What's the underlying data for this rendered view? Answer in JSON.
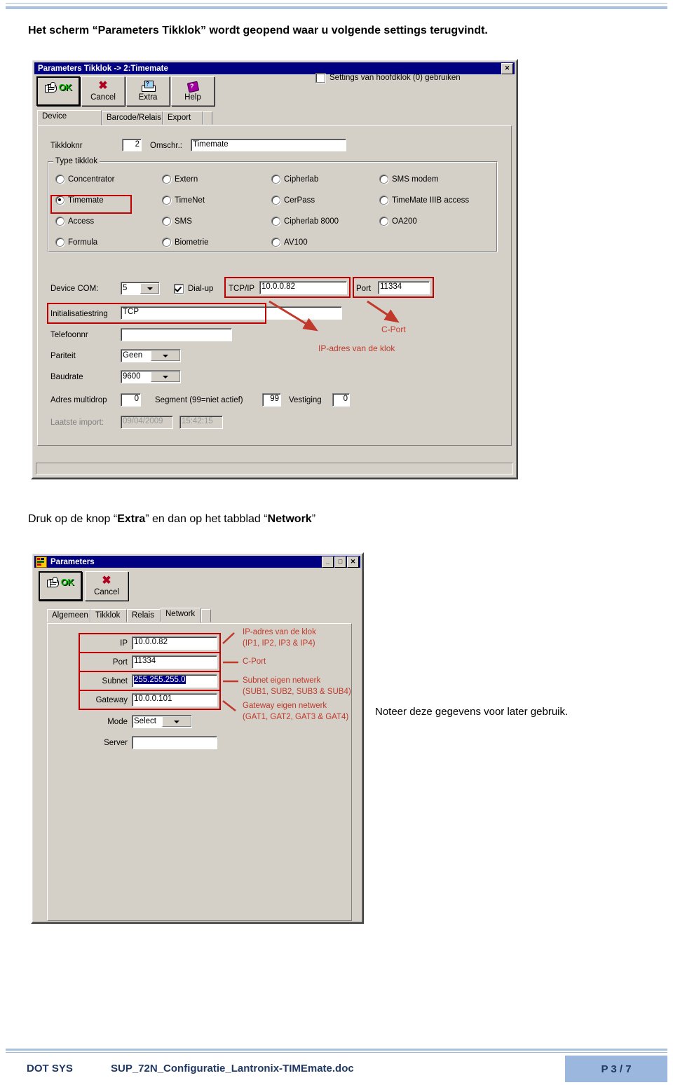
{
  "page": {
    "intro_text": "Het scherm “Parameters Tikklok” wordt geopend waar u volgende settings terugvindt.",
    "mid_text_1": "Druk op de knop “",
    "mid_bold_1": "Extra",
    "mid_text_2": "” en dan op het tabblad “",
    "mid_bold_2": "Network",
    "mid_text_3": "”",
    "note_text": "Noteer deze gegevens voor later gebruik."
  },
  "dialog1": {
    "title": "Parameters Tikklok -> 2:Timemate",
    "close_label": "✕",
    "toolbar": {
      "ok": "OK",
      "cancel": "Cancel",
      "extra": "Extra",
      "help": "Help"
    },
    "master_checkbox_label": "Settings van hoofdklok (0) gebruiken",
    "master_checkbox_checked": false,
    "tabs": [
      {
        "label": "Device",
        "active": true
      },
      {
        "label": "Barcode/Relais",
        "active": false
      },
      {
        "label": "Export",
        "active": false
      }
    ],
    "fields": {
      "tikkloknr_label": "Tikkloknr",
      "tikkloknr_value": "2",
      "omschr_label": "Omschr.:",
      "omschr_value": "Timemate",
      "type_group_title": "Type tikklok",
      "device_com_label": "Device COM:",
      "device_com_value": "5",
      "dialup_label": "Dial-up",
      "dialup_checked": true,
      "tcpip_label": "TCP/IP",
      "tcpip_value": "10.0.0.82",
      "port_label": "Port",
      "port_value": "11334",
      "init_label": "Initialisatiestring",
      "init_value": "TCP",
      "tel_label": "Telefoonnr",
      "tel_value": "",
      "pariteit_label": "Pariteit",
      "pariteit_value": "Geen",
      "baudrate_label": "Baudrate",
      "baudrate_value": "9600",
      "adres_label": "Adres multidrop",
      "adres_value": "0",
      "segment_label": "Segment (99=niet actief)",
      "segment_value": "99",
      "vestiging_label": "Vestiging",
      "vestiging_value": "0",
      "laatste_label": "Laatste import:",
      "laatste_date": "09/04/2009",
      "laatste_time": "15:42:15"
    },
    "radios": [
      {
        "label": "Concentrator",
        "checked": false,
        "col": 0,
        "row": 0
      },
      {
        "label": "Timemate",
        "checked": true,
        "col": 0,
        "row": 1
      },
      {
        "label": "Access",
        "checked": false,
        "col": 0,
        "row": 2
      },
      {
        "label": "Formula",
        "checked": false,
        "col": 0,
        "row": 3
      },
      {
        "label": "Extern",
        "checked": false,
        "col": 1,
        "row": 0
      },
      {
        "label": "TimeNet",
        "checked": false,
        "col": 1,
        "row": 1
      },
      {
        "label": "SMS",
        "checked": false,
        "col": 1,
        "row": 2
      },
      {
        "label": "Biometrie",
        "checked": false,
        "col": 1,
        "row": 3
      },
      {
        "label": "Cipherlab",
        "checked": false,
        "col": 2,
        "row": 0
      },
      {
        "label": "CerPass",
        "checked": false,
        "col": 2,
        "row": 1
      },
      {
        "label": "Cipherlab 8000",
        "checked": false,
        "col": 2,
        "row": 2
      },
      {
        "label": "AV100",
        "checked": false,
        "col": 2,
        "row": 3
      },
      {
        "label": "SMS modem",
        "checked": false,
        "col": 3,
        "row": 0
      },
      {
        "label": "TimeMate IIIB access",
        "checked": false,
        "col": 3,
        "row": 1
      },
      {
        "label": "OA200",
        "checked": false,
        "col": 3,
        "row": 2
      }
    ],
    "annotations": {
      "ip_note": "IP-adres van de klok",
      "cport_note": "C-Port"
    }
  },
  "dialog2": {
    "title": "Parameters",
    "minimize_label": "_",
    "maximize_label": "□",
    "close_label": "✕",
    "toolbar": {
      "ok": "OK",
      "cancel": "Cancel"
    },
    "tabs": [
      {
        "label": "Algemeen",
        "active": false
      },
      {
        "label": "Tikklok",
        "active": false
      },
      {
        "label": "Relais",
        "active": false
      },
      {
        "label": "Network",
        "active": true
      }
    ],
    "fields": {
      "ip_label": "IP",
      "ip_value": "10.0.0.82",
      "port_label": "Port",
      "port_value": "11334",
      "subnet_label": "Subnet",
      "subnet_value": "255.255.255.0",
      "gateway_label": "Gateway",
      "gateway_value": "10.0.0.101",
      "mode_label": "Mode",
      "mode_value": "Select",
      "server_label": "Server",
      "server_value": ""
    },
    "annotations": {
      "ip_l1": "IP-adres van de klok",
      "ip_l2": "(IP1, IP2, IP3 & IP4)",
      "cport": "C-Port",
      "subnet_l1": "Subnet eigen netwerk",
      "subnet_l2": "(SUB1, SUB2, SUB3 & SUB4)",
      "gateway_l1": "Gateway eigen netwerk",
      "gateway_l2": "(GAT1, GAT2, GAT3 & GAT4)"
    }
  },
  "footer": {
    "company": "DOT SYS",
    "document": "SUP_72N_Configuratie_Lantronix-TIMEmate.doc",
    "page": "P 3 / 7"
  },
  "colors": {
    "titlebar": "#000080",
    "annotation_red": "#c0392b",
    "box_red": "#c00000",
    "footer_blue": "#9bb7dd",
    "footer_text": "#1f3864",
    "dialog_face": "#d4d0c8"
  }
}
